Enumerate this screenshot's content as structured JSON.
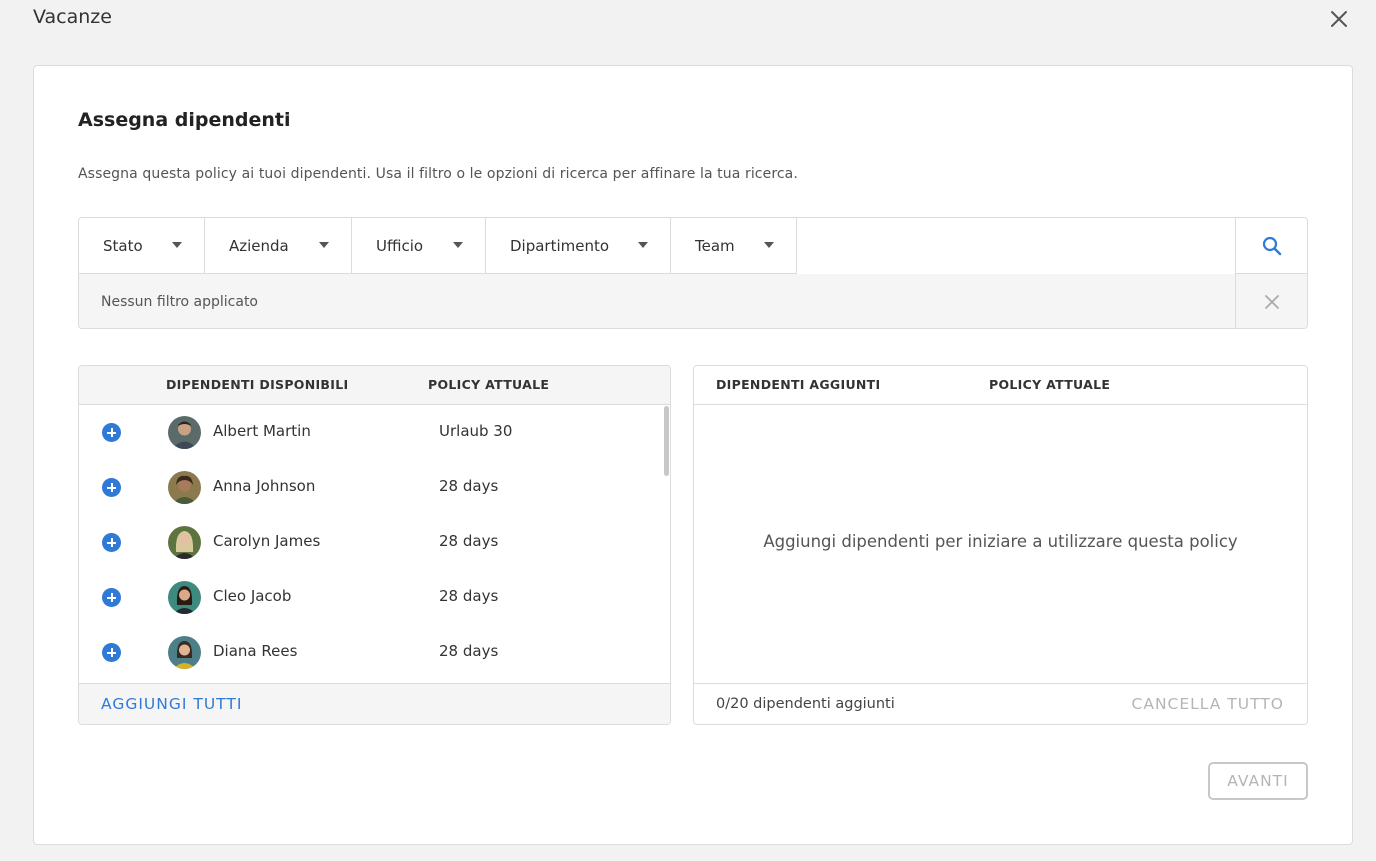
{
  "window": {
    "title": "Vacanze"
  },
  "page": {
    "heading": "Assegna dipendenti",
    "subtitle": "Assegna questa policy ai tuoi dipendenti. Usa il filtro o le opzioni di ricerca per affinare la tua ricerca."
  },
  "filters": {
    "dropdowns": [
      {
        "label": "Stato"
      },
      {
        "label": "Azienda"
      },
      {
        "label": "Ufficio"
      },
      {
        "label": "Dipartimento"
      },
      {
        "label": "Team"
      }
    ],
    "search_value": "",
    "applied_text": "Nessun filtro applicato"
  },
  "available": {
    "col_employees": "DIPENDENTI DISPONIBILI",
    "col_policy": "POLICY ATTUALE",
    "rows": [
      {
        "name": "Albert Martin",
        "policy": "Urlaub 30"
      },
      {
        "name": "Anna Johnson",
        "policy": "28 days"
      },
      {
        "name": "Carolyn James",
        "policy": "28 days"
      },
      {
        "name": "Cleo Jacob",
        "policy": "28 days"
      },
      {
        "name": "Diana Rees",
        "policy": "28 days"
      }
    ],
    "add_all_label": "AGGIUNGI TUTTI"
  },
  "added": {
    "col_employees": "DIPENDENTI AGGIUNTI",
    "col_policy": "POLICY ATTUALE",
    "empty_message": "Aggiungi dipendenti per iniziare a utilizzare questa policy",
    "count_text": "0/20 dipendenti aggiunti",
    "clear_all_label": "CANCELLA TUTTO"
  },
  "actions": {
    "next_label": "AVANTI"
  },
  "colors": {
    "accent": "#2f7ad6",
    "disabled": "#b5b5b5"
  },
  "icons": {
    "close": "close-icon",
    "search": "search-icon",
    "clear": "clear-filter-icon",
    "add": "plus-circle-icon",
    "dropdown": "caret-down-icon"
  }
}
